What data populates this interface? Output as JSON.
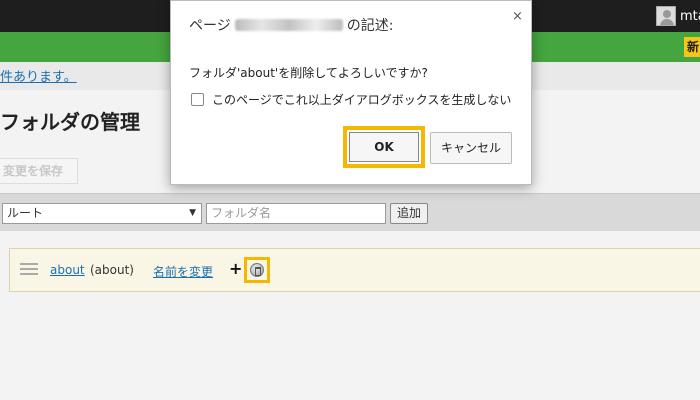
{
  "header": {
    "user_name": "mta",
    "new_button": "新"
  },
  "notice": {
    "text": "件あります。"
  },
  "page": {
    "title": "フォルダの管理",
    "save_button": "変更を保存"
  },
  "toolbar": {
    "parent_select": "ルート",
    "folder_name_placeholder": "フォルダ名",
    "add_button": "追加"
  },
  "folders": [
    {
      "name": "about",
      "key": "(about)",
      "rename_link": "名前を変更",
      "add_icon": "plus-icon",
      "delete_icon": "trash-icon"
    }
  ],
  "dialog": {
    "title_prefix": "ページ",
    "title_suffix": "の記述:",
    "close_icon": "×",
    "message": "フォルダ'about'を削除してよろしいですか?",
    "suppress_label": "このページでこれ以上ダイアログボックスを生成しない",
    "ok_button": "OK",
    "cancel_button": "キャンセル"
  },
  "colors": {
    "highlight": "#f5b800",
    "header_green": "#45a53e",
    "topbar": "#1e1e1e",
    "link": "#1a6fb0"
  }
}
